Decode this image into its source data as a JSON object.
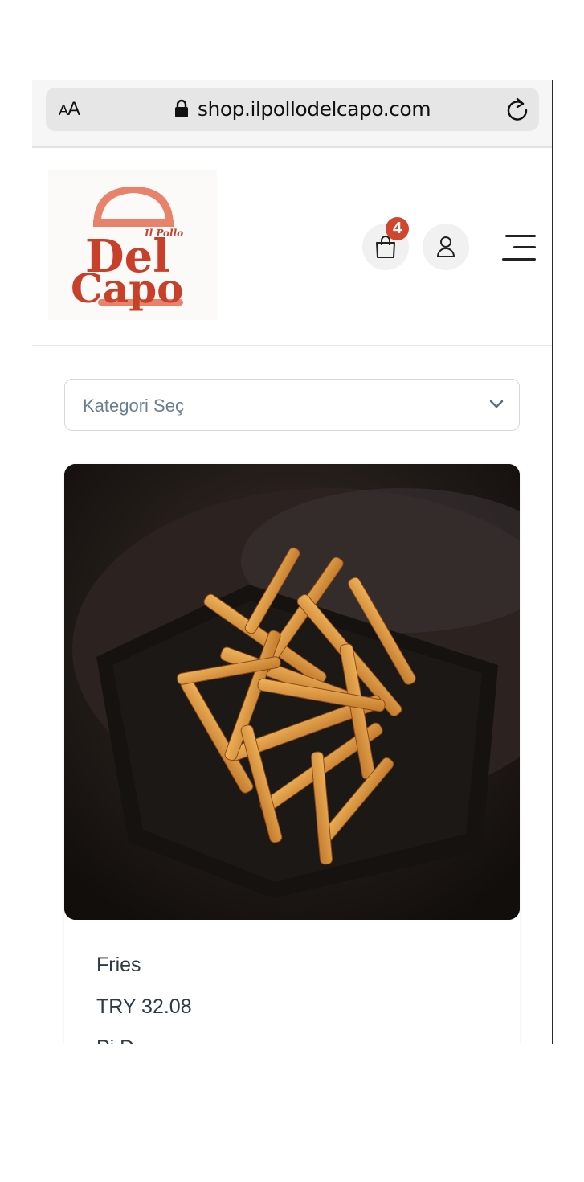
{
  "browser": {
    "aa_label_small": "A",
    "aa_label_large": "A",
    "url": "shop.ilpollodelcapo.com"
  },
  "header": {
    "logo": {
      "small_text": "Il Pollo",
      "line1": "Del",
      "line2": "Capo"
    },
    "cart_count": "4",
    "icons": [
      "shopping-bag-icon",
      "user-icon",
      "hamburger-menu-icon"
    ]
  },
  "filter": {
    "category_label": "Kategori Seç"
  },
  "product": {
    "name": "Fries",
    "price": "TRY 32.08",
    "extra_partial": "Pi  D"
  },
  "colors": {
    "brand_red": "#d2462f",
    "logo_salmon": "#e8826a",
    "logo_red": "#c9402a"
  }
}
